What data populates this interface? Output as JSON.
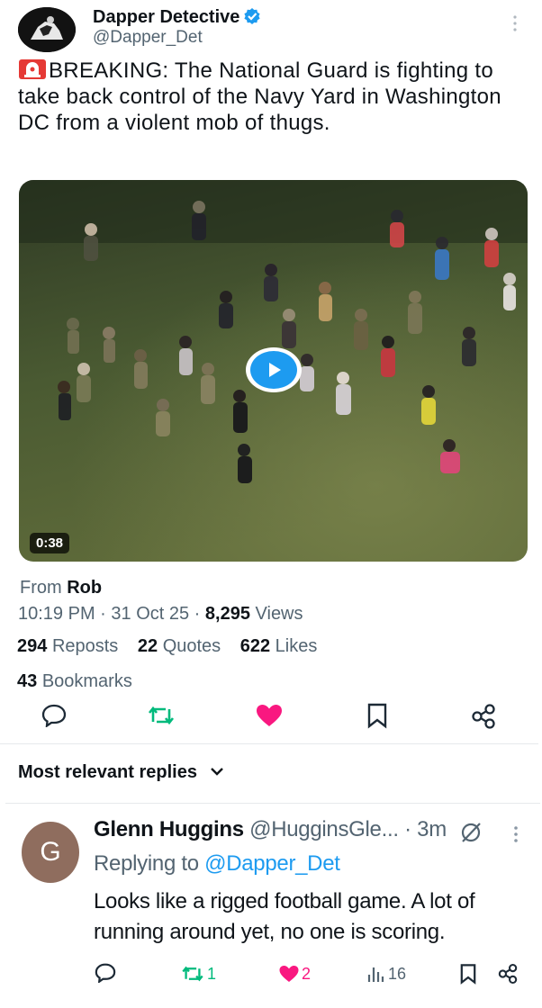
{
  "post": {
    "display_name": "Dapper Detective",
    "handle": "@Dapper_Det",
    "text": "BREAKING: The National Guard is fighting to take back control of the Navy Yard in Washington DC from a violent mob of thugs.",
    "video_duration": "0:38",
    "source_prefix": "From",
    "source_name": "Rob",
    "time": "10:19 PM",
    "date": "31 Oct 25",
    "views_count": "8,295",
    "views_label": "Views",
    "reposts_count": "294",
    "reposts_label": "Reposts",
    "quotes_count": "22",
    "quotes_label": "Quotes",
    "likes_count": "622",
    "likes_label": "Likes",
    "bookmarks_count": "43",
    "bookmarks_label": "Bookmarks"
  },
  "replies_section": {
    "label": "Most relevant replies"
  },
  "reply": {
    "avatar_letter": "G",
    "display_name": "Glenn Huggins",
    "handle": "@HugginsGle...",
    "age": "· 3m",
    "replying_prefix": "Replying to",
    "replying_handle": "@Dapper_Det",
    "text": "Looks like a rigged football game. A lot of running around yet, no one is scoring.",
    "reposts": "1",
    "likes": "2",
    "views": "16"
  },
  "colors": {
    "accent": "#1d9bf0",
    "like": "#f91880",
    "repost": "#00ba7c",
    "muted": "#536471"
  }
}
